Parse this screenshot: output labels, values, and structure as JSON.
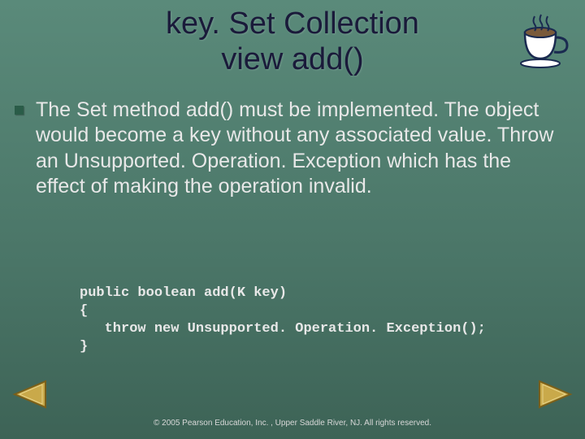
{
  "title_line1": "key. Set Collection",
  "title_line2": "view add()",
  "bullet_text": "The Set method add() must be implemented. The object would become a key without any associated value. Throw an Unsupported. Operation. Exception which has the effect of making the operation invalid.",
  "code": "public boolean add(K key)\n{\n   throw new Unsupported. Operation. Exception();\n}",
  "footer": "© 2005 Pearson Education, Inc. , Upper Saddle River, NJ.  All rights reserved.",
  "icons": {
    "teacup": "teacup-icon",
    "prev": "prev-arrow",
    "next": "next-arrow"
  }
}
